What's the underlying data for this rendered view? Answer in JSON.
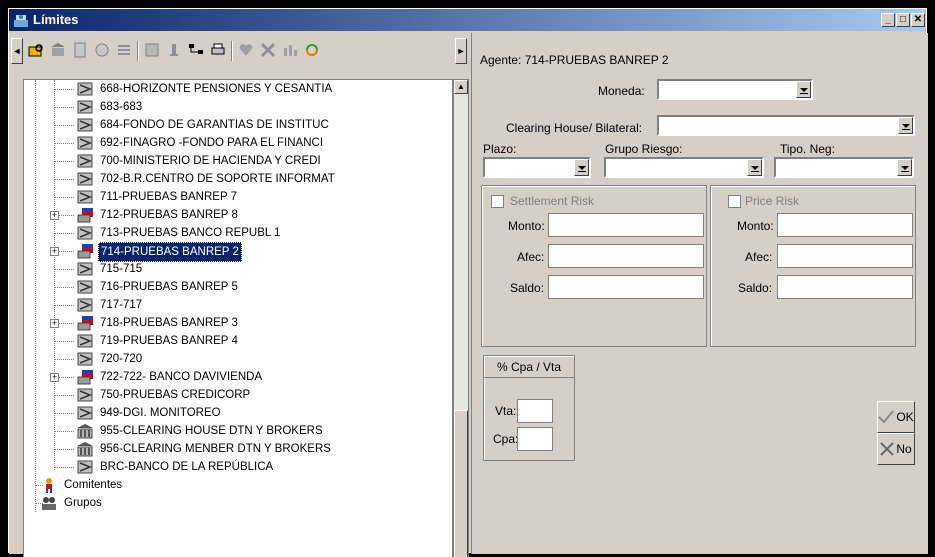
{
  "window": {
    "title": "Límites",
    "controls": {
      "minimize": "_",
      "maximize": "□",
      "close": "✕"
    }
  },
  "toolbar": {
    "icons": [
      "nav-left-icon",
      "search-folder-icon",
      "bank-icon",
      "document-icon",
      "dial-icon",
      "list-icon",
      "edit-icon",
      "pin-icon",
      "tree-icon",
      "print-icon",
      "heart-icon",
      "delete-icon",
      "chart-icon",
      "refresh-icon",
      "nav-right-icon"
    ]
  },
  "tree": {
    "items": [
      {
        "label": "668-HORIZONTE PENSIONES Y CESANTIA",
        "icon": "agent-icon",
        "expandable": false,
        "selected": false
      },
      {
        "label": "683-683",
        "icon": "agent-icon",
        "expandable": false,
        "selected": false
      },
      {
        "label": "684-FONDO DE GARANTIAS DE INSTITUC",
        "icon": "agent-icon",
        "expandable": false,
        "selected": false
      },
      {
        "label": "692-FINAGRO -FONDO PARA EL FINANCI",
        "icon": "agent-icon",
        "expandable": false,
        "selected": false
      },
      {
        "label": "700-MINISTERIO DE HACIENDA Y CREDI",
        "icon": "agent-icon",
        "expandable": false,
        "selected": false
      },
      {
        "label": "702-B.R.CENTRO DE SOPORTE INFORMAT",
        "icon": "agent-icon",
        "expandable": false,
        "selected": false
      },
      {
        "label": "711-PRUEBAS BANREP 7",
        "icon": "agent-icon",
        "expandable": false,
        "selected": false
      },
      {
        "label": "712-PRUEBAS BANREP 8",
        "icon": "flag-agent-icon",
        "expandable": true,
        "selected": false
      },
      {
        "label": "713-PRUEBAS BANCO REPUBL 1",
        "icon": "agent-icon",
        "expandable": false,
        "selected": false
      },
      {
        "label": "714-PRUEBAS BANREP 2",
        "icon": "flag-agent-icon",
        "expandable": true,
        "selected": true
      },
      {
        "label": "715-715",
        "icon": "agent-icon",
        "expandable": false,
        "selected": false
      },
      {
        "label": "716-PRUEBAS BANREP 5",
        "icon": "agent-icon",
        "expandable": false,
        "selected": false
      },
      {
        "label": "717-717",
        "icon": "agent-icon",
        "expandable": false,
        "selected": false
      },
      {
        "label": "718-PRUEBAS BANREP 3",
        "icon": "flag-agent-icon",
        "expandable": true,
        "selected": false
      },
      {
        "label": "719-PRUEBAS BANREP 4",
        "icon": "agent-icon",
        "expandable": false,
        "selected": false
      },
      {
        "label": "720-720",
        "icon": "agent-icon",
        "expandable": false,
        "selected": false
      },
      {
        "label": "722-722- BANCO DAVIVIENDA",
        "icon": "flag-agent-icon",
        "expandable": true,
        "selected": false
      },
      {
        "label": "750-PRUEBAS CREDICORP",
        "icon": "agent-icon",
        "expandable": false,
        "selected": false
      },
      {
        "label": "949-DGI. MONITOREO",
        "icon": "agent-icon",
        "expandable": false,
        "selected": false
      },
      {
        "label": "955-CLEARING HOUSE DTN Y BROKERS",
        "icon": "bank-icon",
        "expandable": false,
        "selected": false
      },
      {
        "label": "956-CLEARING MENBER DTN Y BROKERS",
        "icon": "bank-icon",
        "expandable": false,
        "selected": false
      },
      {
        "label": "BRC-BANCO DE LA REPÚBLICA",
        "icon": "agent-icon",
        "expandable": false,
        "selected": false
      }
    ],
    "root_items": [
      {
        "label": "Comitentes",
        "icon": "person-icon"
      },
      {
        "label": "Grupos",
        "icon": "group-icon"
      }
    ]
  },
  "form": {
    "agent_label": "Agente: 714-PRUEBAS BANREP 2",
    "moneda_label": "Moneda:",
    "moneda_value": "",
    "clearing_label": "Clearing House/ Bilateral:",
    "clearing_value": "",
    "plazo_label": "Plazo:",
    "plazo_value": "",
    "grupo_riesgo_label": "Grupo Riesgo:",
    "grupo_riesgo_value": "",
    "tipo_neg_label": "Tipo. Neg:",
    "tipo_neg_value": "",
    "settlement": {
      "title": "Settlement Risk",
      "checked": false,
      "monto_label": "Monto:",
      "afec_label": "Afec:",
      "saldo_label": "Saldo:",
      "monto": "",
      "afec": "",
      "saldo": ""
    },
    "price": {
      "title": "Price Risk",
      "checked": false,
      "monto_label": "Monto:",
      "afec_label": "Afec:",
      "saldo_label": "Saldo:",
      "monto": "",
      "afec": "",
      "saldo": ""
    },
    "cpa_vta": {
      "title": "% Cpa / Vta",
      "vta_label": "Vta:",
      "cpa_label": "Cpa:",
      "vta": "",
      "cpa": ""
    },
    "ok_label": "OK",
    "no_label": "No"
  },
  "colors": {
    "titlebar_start": "#0a246a",
    "titlebar_end": "#a6caf0",
    "selection": "#0a246a",
    "face": "#d4d0c8"
  }
}
